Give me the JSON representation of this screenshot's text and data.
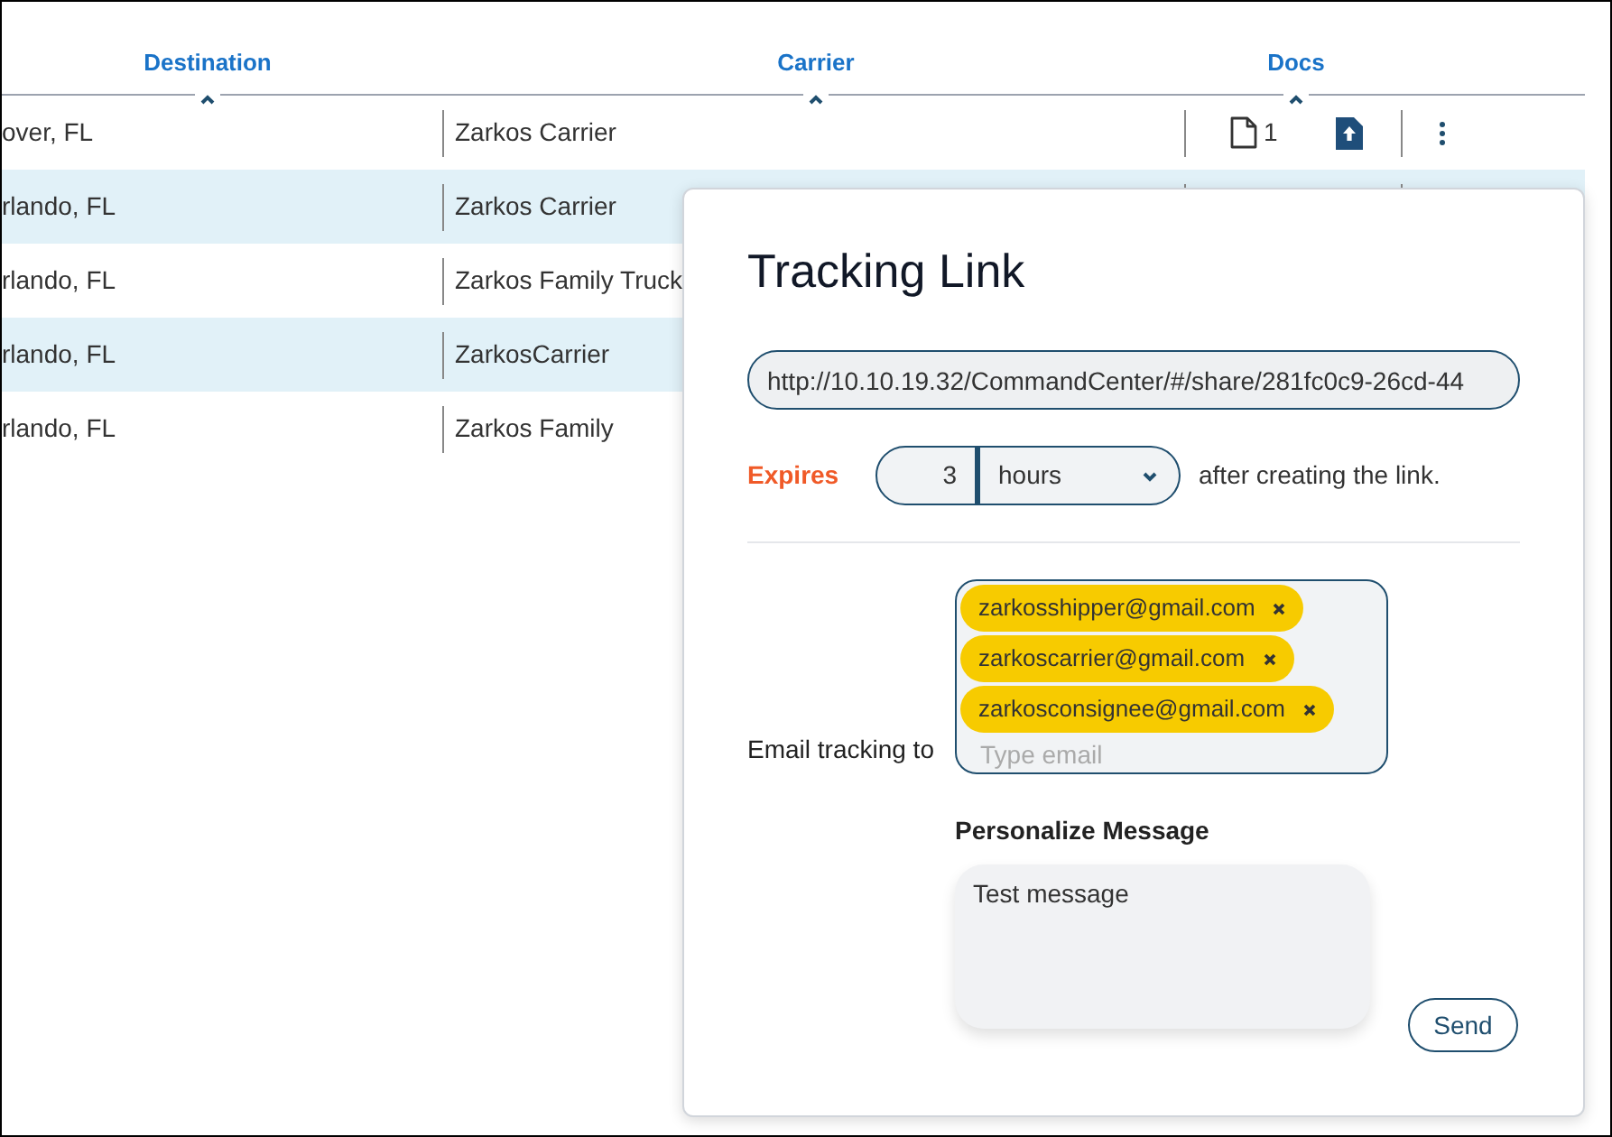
{
  "table": {
    "columns": [
      {
        "label": "Destination"
      },
      {
        "label": "Carrier"
      },
      {
        "label": "Docs"
      }
    ],
    "rows": [
      {
        "destination": "over, FL",
        "carrier": "Zarkos Carrier",
        "doc_count": "1",
        "selected": false
      },
      {
        "destination": "rlando, FL",
        "carrier": "Zarkos Carrier",
        "selected": true
      },
      {
        "destination": "rlando, FL",
        "carrier": "Zarkos Family Truck",
        "selected": false
      },
      {
        "destination": "rlando, FL",
        "carrier": "ZarkosCarrier",
        "selected": true
      },
      {
        "destination": "rlando, FL",
        "carrier": "Zarkos Family",
        "selected": false
      }
    ]
  },
  "popup": {
    "title": "Tracking Link",
    "link": "http://10.10.19.32/CommandCenter/#/share/281fc0c9-26cd-44",
    "expires": {
      "label": "Expires",
      "amount": "3",
      "unit": "hours",
      "suffix": "after creating the link."
    },
    "email": {
      "label": "Email tracking to",
      "recipients": [
        "zarkosshipper@gmail.com",
        "zarkoscarrier@gmail.com",
        "zarkosconsignee@gmail.com"
      ],
      "placeholder": "Type email"
    },
    "message": {
      "label": "Personalize Message",
      "value": "Test message"
    },
    "send_button": "Send"
  }
}
